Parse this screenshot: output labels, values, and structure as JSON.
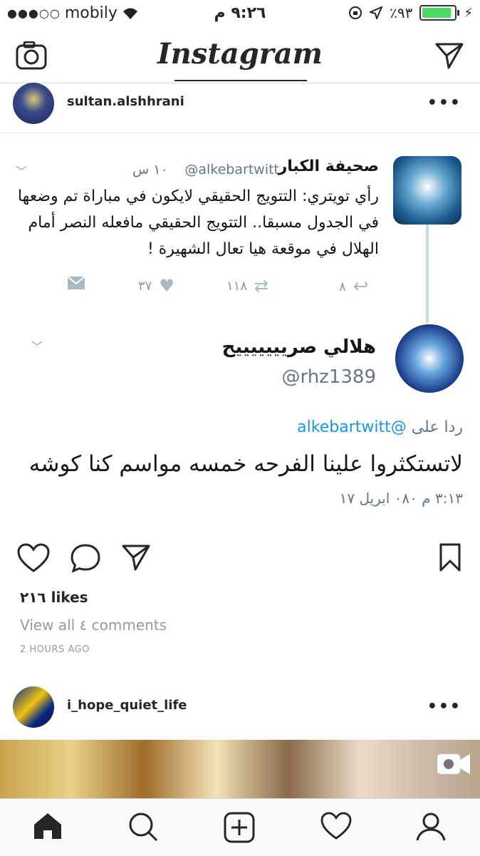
{
  "status_bar": {
    "carrier": "mobily",
    "time": "٩:٢٦ م",
    "battery_percent": "٪٩٣",
    "signal_bars": 3
  },
  "header": {
    "logo": "Instagram"
  },
  "post1": {
    "username": "sultan.alshhrani",
    "more": "•••",
    "tweet": {
      "name": "صحيفة الكبار",
      "handle": "@alkebartwitt",
      "time": "١٠ س",
      "text": "رأي تويتري: التتويج الحقيقي لايكون في مباراة تم وضعها في الجدول مسبقا.. التتويج الحقيقي مافعله النصر أمام الهلال في موقعة هيا تعال الشهيرة !",
      "reply_count": "٨",
      "retweet_count": "١١٨",
      "like_count": "٣٧"
    },
    "reply": {
      "name": "هلالي صريييييييح",
      "handle": "@rhz1389",
      "replying_prefix": "ردا على",
      "replying_handle": "@alkebartwitt",
      "text": "لاتستكثروا علينا الفرحه خمسه مواسم كنا كوشه",
      "timestamp": "٣:١٣ م ٠٨٠ ابريل ١٧"
    },
    "likes": "٢١٦ likes",
    "view_comments": "View all ٤ comments",
    "time_ago": "2 HOURS AGO"
  },
  "post2": {
    "username": "i_hope_quiet_life",
    "more": "•••"
  },
  "icons": {
    "camera": "camera-icon",
    "direct": "direct-message-icon",
    "home": "home-icon",
    "search": "search-icon",
    "add": "add-post-icon",
    "activity": "heart-icon",
    "profile": "profile-icon"
  }
}
